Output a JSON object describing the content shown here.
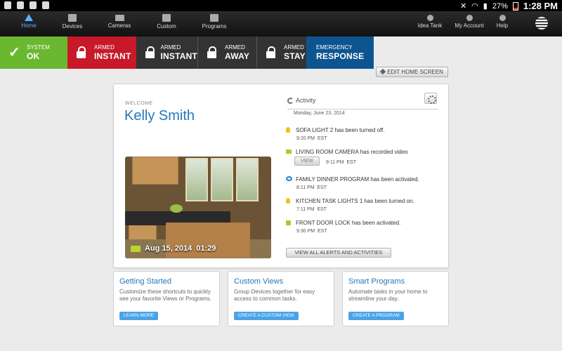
{
  "statusbar": {
    "battery": "27%",
    "time": "1:28 PM"
  },
  "nav": {
    "items": [
      {
        "label": "Home",
        "icon": "house-icon"
      },
      {
        "label": "Devices",
        "icon": "list-icon"
      },
      {
        "label": "Cameras",
        "icon": "camera-icon"
      },
      {
        "label": "Custom",
        "icon": "custom-icon"
      },
      {
        "label": "Programs",
        "icon": "programs-icon"
      }
    ],
    "right_items": [
      {
        "label": "Idea Tank",
        "icon": "lightbulb-icon"
      },
      {
        "label": "My Account",
        "icon": "wrench-icon"
      },
      {
        "label": "Help",
        "icon": "help-icon"
      }
    ]
  },
  "armbar": {
    "system": {
      "small": "SYSTEM",
      "big": "OK",
      "color": "#6ab82f"
    },
    "armed_instant_current": {
      "small": "ARMED",
      "big": "INSTANT",
      "color": "#c8192a"
    },
    "armed_instant": {
      "small": "ARMED",
      "big": "INSTANT"
    },
    "armed_away": {
      "small": "ARMED",
      "big": "AWAY"
    },
    "armed_stay": {
      "small": "ARMED",
      "big": "STAY"
    },
    "emergency": {
      "small": "EMERGENCY",
      "big": "RESPONSE",
      "color": "#0d5591"
    }
  },
  "edit_home_screen": "EDIT HOME SCREEN",
  "welcome": {
    "label": "WELCOME",
    "name": "Kelly Smith"
  },
  "camera_snapshot": {
    "date": "Aug 15, 2014",
    "time": "01:29"
  },
  "activity": {
    "title": "Activity",
    "date": "Monday, June 23, 2014",
    "items": [
      {
        "device": "SOFA LIGHT 2",
        "text": " has been turned off.",
        "time": "9:20 PM",
        "tz": "EST",
        "icon": "lightbulb-icon"
      },
      {
        "device": "LIVING ROOM CAMERA",
        "text": " has recorded video",
        "time": "9:11 PM",
        "tz": "EST",
        "icon": "video-camera-icon",
        "action": "VIEW"
      },
      {
        "device": "FAMILY DINNER PROGRAM",
        "text": " has been activated.",
        "time": "8:11 PM",
        "tz": "EST",
        "icon": "program-icon"
      },
      {
        "device": "KITCHEN TASK LIGHTS 1",
        "text": " has been turned on.",
        "time": "7:11 PM",
        "tz": "EST",
        "icon": "lightbulb-icon"
      },
      {
        "device": "FRONT DOOR LOCK",
        "text": " has been activated.",
        "time": "9:30 PM",
        "tz": "EST",
        "icon": "lock-icon"
      }
    ],
    "view_all": "VIEW ALL ALERTS AND ACTIVITIES"
  },
  "tiles": [
    {
      "title": "Getting Started",
      "desc": "Customize these shortcuts to quickly see your favorite Views or Programs.",
      "button": "LEARN MORE"
    },
    {
      "title": "Custom Views",
      "desc": "Group Devices together for easy access to common tasks.",
      "button": "CREATE A CUSTOM VIEW"
    },
    {
      "title": "Smart Programs",
      "desc": "Automate tasks in your home to streamline your day.",
      "button": "CREATE A PROGRAM"
    }
  ]
}
